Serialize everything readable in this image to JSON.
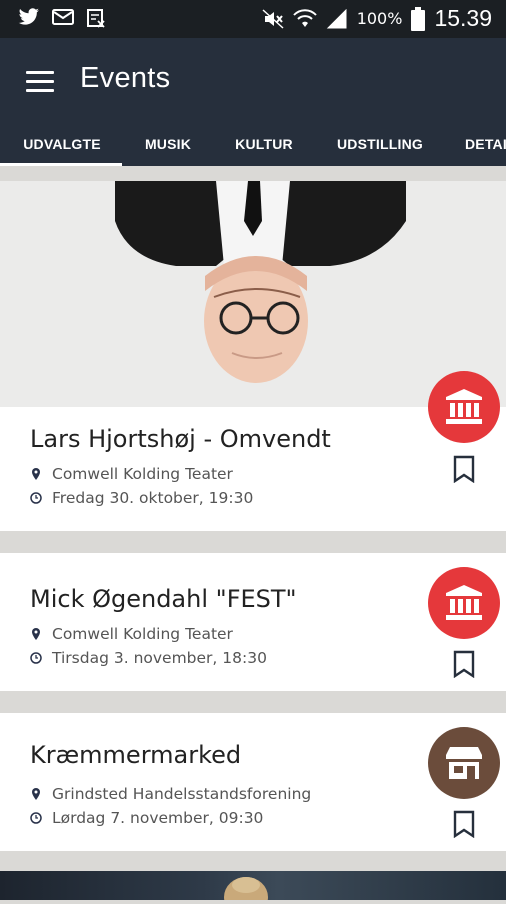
{
  "status_bar": {
    "icons": [
      "twitter-icon",
      "email-icon",
      "calendar-x-icon"
    ],
    "right_icons": [
      "mute-icon",
      "wifi-icon",
      "signal-icon"
    ],
    "battery": "100%",
    "time": "15.39"
  },
  "app_bar": {
    "title": "Events",
    "tabs": [
      {
        "label": "UDVALGTE",
        "active": true
      },
      {
        "label": "MUSIK",
        "active": false
      },
      {
        "label": "KULTUR",
        "active": false
      },
      {
        "label": "UDSTILLING",
        "active": false
      },
      {
        "label": "DETAI",
        "active": false
      }
    ]
  },
  "events": [
    {
      "title": "Lars Hjortshøj - Omvendt",
      "venue": "Comwell Kolding Teater",
      "datetime": "Fredag 30. oktober, 19:30",
      "category_icon": "theater-icon",
      "category_color": "#e5383b"
    },
    {
      "title": "Mick Øgendahl \"FEST\"",
      "venue": "Comwell Kolding Teater",
      "datetime": "Tirsdag 3. november, 18:30",
      "category_icon": "theater-icon",
      "category_color": "#e5383b"
    },
    {
      "title": "Kræmmermarked",
      "venue": "Grindsted Handelsstandsforening",
      "datetime": "Lørdag 7. november, 09:30",
      "category_icon": "shop-icon",
      "category_color": "#6b4c3b"
    }
  ],
  "colors": {
    "app_bar": "#262f3c",
    "accent_red": "#e5383b",
    "accent_brown": "#6b4c3b"
  }
}
